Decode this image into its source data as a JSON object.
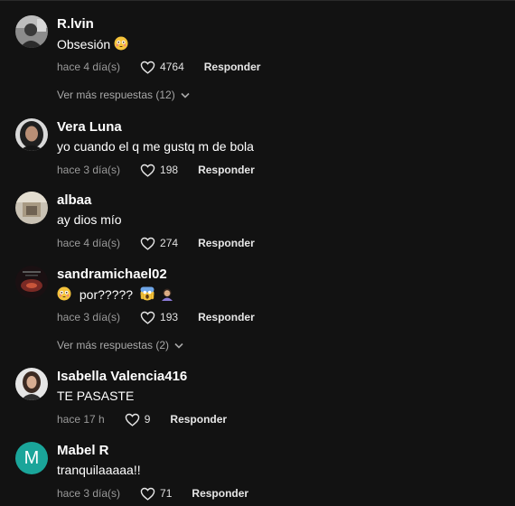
{
  "colors": {
    "background": "#121212",
    "text": "#ffffff",
    "muted": "#9a9a9a",
    "avatar_letter_bg": "#1aa59a"
  },
  "comments": [
    {
      "username": "R.lvin",
      "text": "Obsesión",
      "emojis": [
        "flushed-face-emoji"
      ],
      "time": "hace 4 día(s)",
      "likes": "4764",
      "reply_label": "Responder",
      "more_replies": "Ver más respuestas (12)"
    },
    {
      "username": "Vera Luna",
      "text": "yo cuando el q me gustq m de bola",
      "time": "hace 3 día(s)",
      "likes": "198",
      "reply_label": "Responder"
    },
    {
      "username": "albaa",
      "text": "ay dios mío",
      "time": "hace 4 día(s)",
      "likes": "274",
      "reply_label": "Responder"
    },
    {
      "username": "sandramichael02",
      "text": "por?????",
      "emojis": [
        "flushed-face-emoji",
        "screaming-face-emoji",
        "person-facepalming-emoji"
      ],
      "time": "hace 3 día(s)",
      "likes": "193",
      "reply_label": "Responder",
      "more_replies": "Ver más respuestas (2)"
    },
    {
      "username": "Isabella Valencia416",
      "text": "TE PASASTE",
      "time": "hace 17 h",
      "likes": "9",
      "reply_label": "Responder"
    },
    {
      "username": "Mabel R",
      "avatar_letter": "M",
      "text": "tranquilaaaaa!!",
      "time": "hace 3 día(s)",
      "likes": "71",
      "reply_label": "Responder"
    }
  ]
}
